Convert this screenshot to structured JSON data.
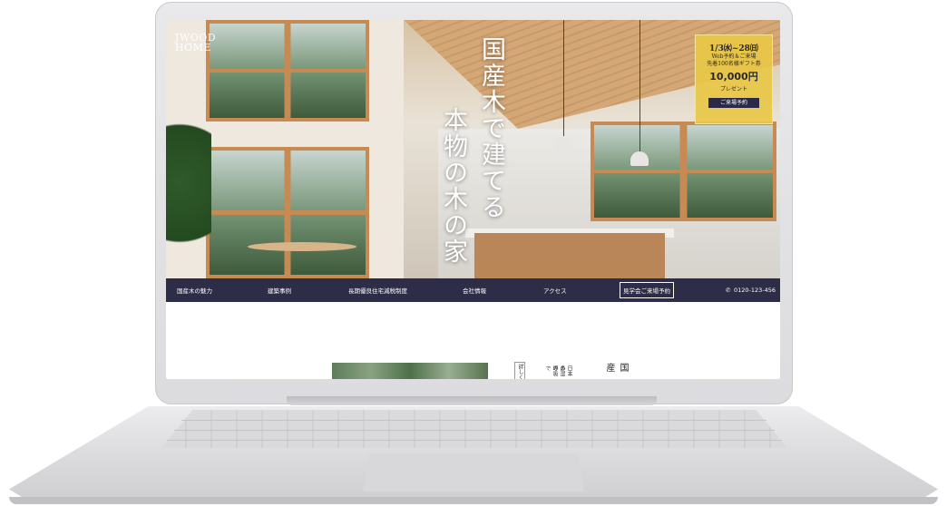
{
  "site": {
    "logo_line1": "JWOOD",
    "logo_line2": "HOME"
  },
  "hero": {
    "title_col1": "国産木で建てる",
    "title_col2": "本物の木の家"
  },
  "campaign": {
    "dates": "1/3㈬~28㈰",
    "line1": "Web予約＆ご来場",
    "line2": "先着100名様ギフト券",
    "amount": "10,000円",
    "present": "プレゼント",
    "button": "ご来場予約",
    "bg_color": "#e8c746"
  },
  "nav": {
    "items": [
      "国産木の魅力",
      "建築事例",
      "長期優良住宅減税制度",
      "会社情報",
      "アクセス"
    ],
    "visit_button": "見学会ご来場予約",
    "phone": "0120-123-456",
    "bg_color": "#2e2d47"
  },
  "below": {
    "detail_button": "詳しく",
    "text_col1": "日本の",
    "text_col2": "多湿の",
    "text_col3": "呼吸で",
    "heading": "国産"
  }
}
